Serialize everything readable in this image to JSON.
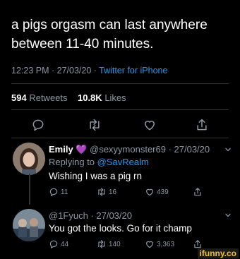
{
  "tweet": {
    "text": "a pigs orgasm can last anywhere between 11-40 minutes.",
    "time": "12:23 PM · 27/03/20 · ",
    "client": "Twitter for iPhone",
    "retweets_count": "594",
    "retweets_label": "Retweets",
    "likes_count": "10.8K",
    "likes_label": "Likes"
  },
  "actions": {
    "reply_icon": "comment-icon",
    "retweet_icon": "retweet-icon",
    "like_icon": "heart-icon",
    "share_icon": "share-icon"
  },
  "replies": [
    {
      "name": "Emily",
      "emoji": "💜",
      "handle": "@sexyymonster69 · 27/03/20",
      "replying_prefix": "Replying to ",
      "replying_to": "@SavRealm",
      "text": "Wishing I was a pig rn",
      "reply_count": "11",
      "retweet_count": "16",
      "like_count": "439"
    },
    {
      "handle": "@1Fyuch · 27/03/20",
      "text": "You got the looks. Go for it champ",
      "reply_count": "44",
      "retweet_count": "140",
      "like_count": "3,363"
    }
  ],
  "watermark": "ifunny.co",
  "colors": {
    "background": "#000000",
    "text": "#ffffff",
    "muted": "#8b98a5",
    "link": "#1d9bf0",
    "watermark": "#f2c230"
  }
}
